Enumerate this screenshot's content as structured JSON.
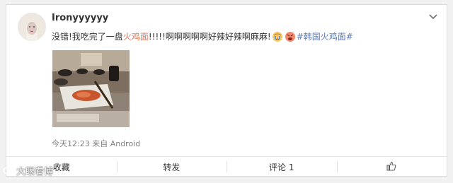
{
  "post": {
    "username": "Ironyyyyyy",
    "text_prefix": "没错!我吃完了一盘",
    "text_highlight": "火鸡面",
    "text_suffix": "!!!!!啊啊啊啊啊好辣好辣啊麻麻!",
    "hashtag": "#韩国火鸡面#",
    "timestamp": "今天12:23",
    "source_prefix": "来自",
    "source": "Android"
  },
  "actions": {
    "favorite": "收藏",
    "repost": "转发",
    "comment": "评论 1"
  },
  "watermark": {
    "text": "大眼看博"
  },
  "colors": {
    "highlight": "#eb7350",
    "link": "#5d7ab5"
  }
}
